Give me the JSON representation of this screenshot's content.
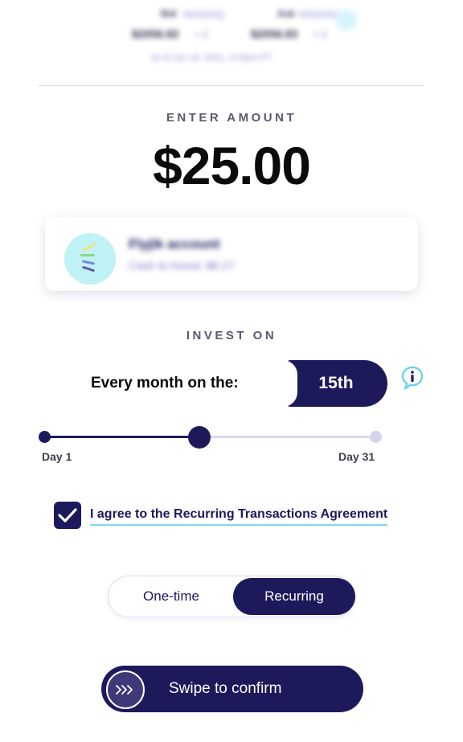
{
  "header": {
    "bid_label": "Bid",
    "bid_exchange": "NASDAQ",
    "bid_price": "$2056.82",
    "bid_size": "× 3",
    "ask_label": "Ask",
    "ask_exchange": "NASDAQ",
    "ask_price": "$2056.83",
    "ask_size": "× 2",
    "timestamp": "as of Jun 15, 2021, 4:15pm PT"
  },
  "amount": {
    "label": "ENTER AMOUNT",
    "value": "$25.00"
  },
  "account": {
    "name": "Flyjik account",
    "detail": "Cash to invest: $6.27"
  },
  "invest": {
    "label": "INVEST ON",
    "every_label": "Every month on the:",
    "day_value": "15th",
    "slider_start": "Day 1",
    "slider_end": "Day 31",
    "slider_fraction": 0.467
  },
  "agreement": {
    "checked": true,
    "label": "I agree to the Recurring Transactions Agreement"
  },
  "mode": {
    "options": [
      "One-time",
      "Recurring"
    ],
    "selected": "Recurring"
  },
  "confirm": {
    "label": "Swipe to confirm"
  },
  "colors": {
    "primary": "#1d1a5c",
    "accent": "#7fd8f0",
    "track": "#d9d8ef"
  },
  "icons": {
    "info": "info-icon",
    "check": "check-icon",
    "swipe": "chevrons-right-icon"
  }
}
